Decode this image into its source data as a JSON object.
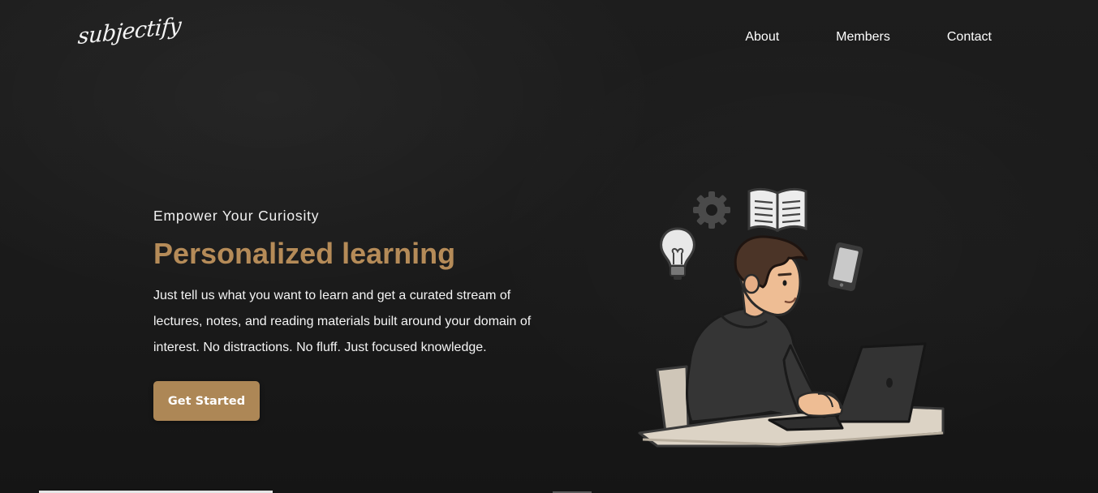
{
  "header": {
    "logo_text": "subjectify",
    "nav": [
      {
        "label": "About"
      },
      {
        "label": "Members"
      },
      {
        "label": "Contact"
      }
    ]
  },
  "hero": {
    "eyebrow": "Empower Your Curiosity",
    "headline": "Personalized learning",
    "description": "Just tell us what you want to learn and get a curated stream of lectures, notes, and reading materials built around your domain of interest. No distractions. No fluff. Just focused knowledge.",
    "cta_label": "Get Started"
  },
  "colors": {
    "background": "#1c1c1c",
    "accent": "#b58b58",
    "button": "#ad8756",
    "text": "#f2f2f2"
  },
  "icons": [
    "gear-icon",
    "book-icon",
    "lightbulb-icon",
    "phone-icon",
    "laptop-icon"
  ]
}
